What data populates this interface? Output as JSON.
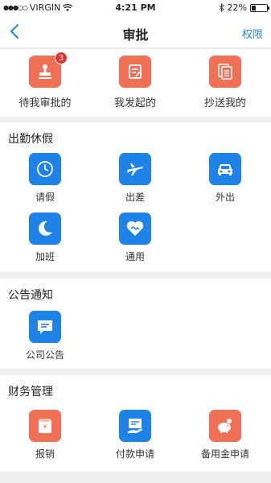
{
  "status_bar": {
    "carrier": "VIRGIN",
    "time": "4:21 PM",
    "battery": "22%"
  },
  "nav": {
    "title": "审批",
    "right_action": "权限"
  },
  "top_actions": [
    {
      "label": "待我审批的",
      "badge": "3",
      "icon": "stamp-icon"
    },
    {
      "label": "我发起的",
      "icon": "form-edit-icon"
    },
    {
      "label": "抄送我的",
      "icon": "documents-copy-icon"
    }
  ],
  "sections": [
    {
      "title": "出勤休假",
      "items": [
        {
          "label": "请假",
          "icon": "clock-icon"
        },
        {
          "label": "出差",
          "icon": "airplane-icon"
        },
        {
          "label": "外出",
          "icon": "car-icon"
        },
        {
          "label": "加班",
          "icon": "moon-icon"
        },
        {
          "label": "通用",
          "icon": "handshake-icon"
        }
      ]
    },
    {
      "title": "公告通知",
      "items": [
        {
          "label": "公司公告",
          "icon": "message-icon"
        }
      ]
    },
    {
      "title": "财务管理",
      "items": [
        {
          "label": "报销",
          "icon": "wallet-icon"
        },
        {
          "label": "付款申请",
          "icon": "payment-card-icon"
        },
        {
          "label": "备用金申请",
          "icon": "piggy-bank-icon"
        }
      ]
    }
  ],
  "colors": {
    "orange": "#f07055",
    "blue": "#1e82e6",
    "link": "#2a8bd8",
    "badge": "#e6322e"
  }
}
